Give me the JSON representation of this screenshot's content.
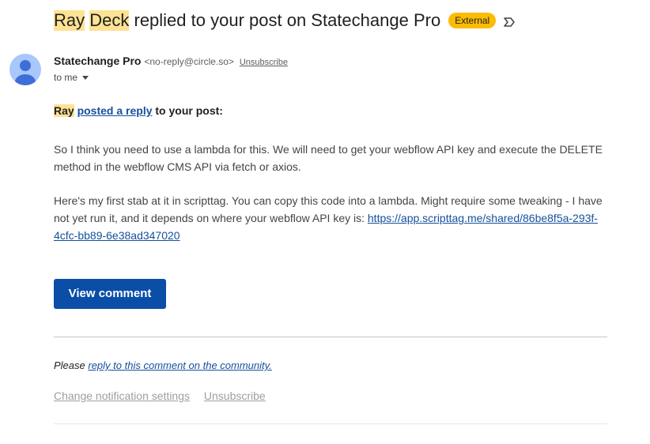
{
  "subject": {
    "highlight1": "Ray",
    "highlight2": "Deck",
    "rest": " replied to your post on Statechange Pro",
    "badge": "External"
  },
  "sender": {
    "name": "Statechange Pro",
    "email": "<no-reply@circle.so>",
    "unsubscribe": "Unsubscribe",
    "to": "to me"
  },
  "message": {
    "author": "Ray",
    "action_link": "posted a reply",
    "action_rest": " to your post:",
    "paragraph1": "So I think you need to use a lambda for this. We will need to get your webflow API key and execute the DELETE method in the webflow CMS API via fetch or axios.",
    "paragraph2": "Here's my first stab at it in scripttag. You can copy this code into a lambda. Might require some tweaking - I have not yet run it, and it depends on where your webflow API key is: ",
    "paragraph2_link": "https://app.scripttag.me/shared/86be8f5a-293f-4cfc-bb89-6e38ad347020",
    "button_label": "View comment"
  },
  "footer": {
    "please": "Please ",
    "reply_link": "reply to this comment on the community.",
    "change_settings": "Change notification settings",
    "unsubscribe": "Unsubscribe"
  },
  "colors": {
    "highlight": "#fde293",
    "badge": "#fbbc04",
    "button": "#0a4ea8",
    "link": "#15509c",
    "avatar": "#a8c7fa"
  },
  "icons": {
    "label": "label-outline-icon",
    "avatar": "person-icon",
    "caret": "caret-down-icon"
  }
}
